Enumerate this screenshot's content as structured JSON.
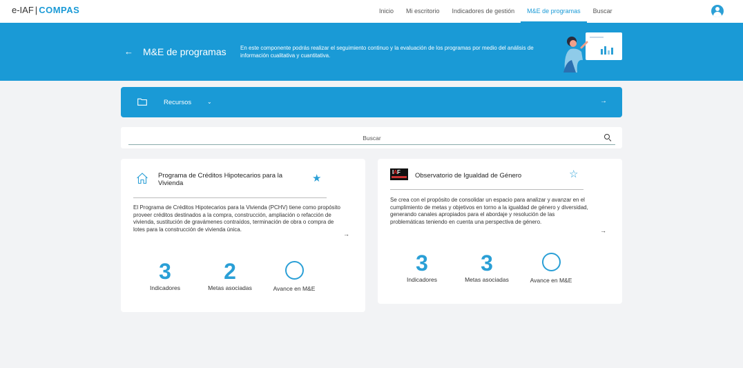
{
  "nav": {
    "brand_prefix": "e-IAF",
    "brand_sep": "|",
    "brand_name": "COMPAS",
    "links": [
      "Inicio",
      "Mi escritorio",
      "Indicadores de gestión",
      "M&E de programas",
      "Buscar"
    ],
    "active_link": "M&E de programas"
  },
  "hero": {
    "title": "M&E de programas",
    "description": "En este componente podrás realizar el seguimiento continuo y la evaluación de los programas por medio del análisis de información cualitativa y cuantitativa."
  },
  "recursos": {
    "label": "Recursos"
  },
  "search": {
    "placeholder": "Buscar"
  },
  "programs": [
    {
      "title": "Programa de Créditos Hipotecarios para la Vivienda",
      "icon": "house-icon",
      "favorited": true,
      "description": "El Programa de Créditos Hipotecarios para la Vivienda (PCHV) tiene como propósito proveer créditos destinados a la compra, construcción, ampliación o refacción de vivienda, sustitución de gravámenes contraídos, terminación de obra o compra de lotes para la construcción de vivienda única.",
      "indicators": "3",
      "indicators_label": "Indicadores",
      "goals": "2",
      "goals_label": "Metas asociadas",
      "progress_label": "Avance en M&E"
    },
    {
      "title": "Observatorio de Igualdad de Género",
      "icon": "iaf-logo",
      "favorited": false,
      "description": "Se crea con el propósito de consolidar un espacio para analizar y avanzar en el cumplimiento de metas y objetivos en torno a la igualdad de género y diversidad, generando canales apropiados para el abordaje y resolución de las problemáticas teniendo en cuenta una perspectiva de género.",
      "indicators": "3",
      "indicators_label": "Indicadores",
      "goals": "3",
      "goals_label": "Metas asociadas",
      "progress_label": "Avance en M&E"
    }
  ],
  "colors": {
    "accent": "#1a9ad6",
    "background": "#f2f3f5"
  }
}
